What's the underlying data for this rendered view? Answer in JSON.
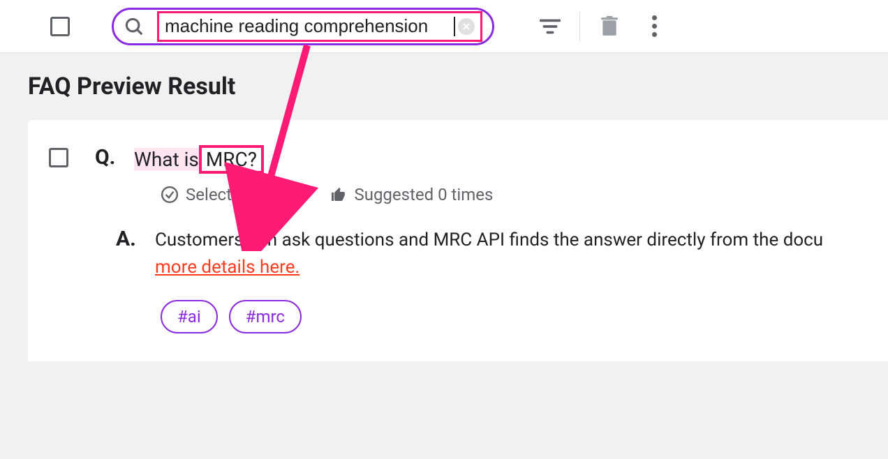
{
  "toolbar": {
    "search_value": "machine reading comprehension"
  },
  "page": {
    "title": "FAQ Preview Result"
  },
  "faq": {
    "q_letter": "Q.",
    "a_letter": "A.",
    "question_prefix": "What is",
    "question_highlight": " MRC?",
    "selected_label": "Selected 0 times",
    "suggested_label": "Suggested 0 times",
    "answer_text": "Customers can ask questions and MRC API finds the answer directly from the docu",
    "answer_link": "more details here.",
    "tags": [
      "#ai",
      "#mrc"
    ]
  }
}
